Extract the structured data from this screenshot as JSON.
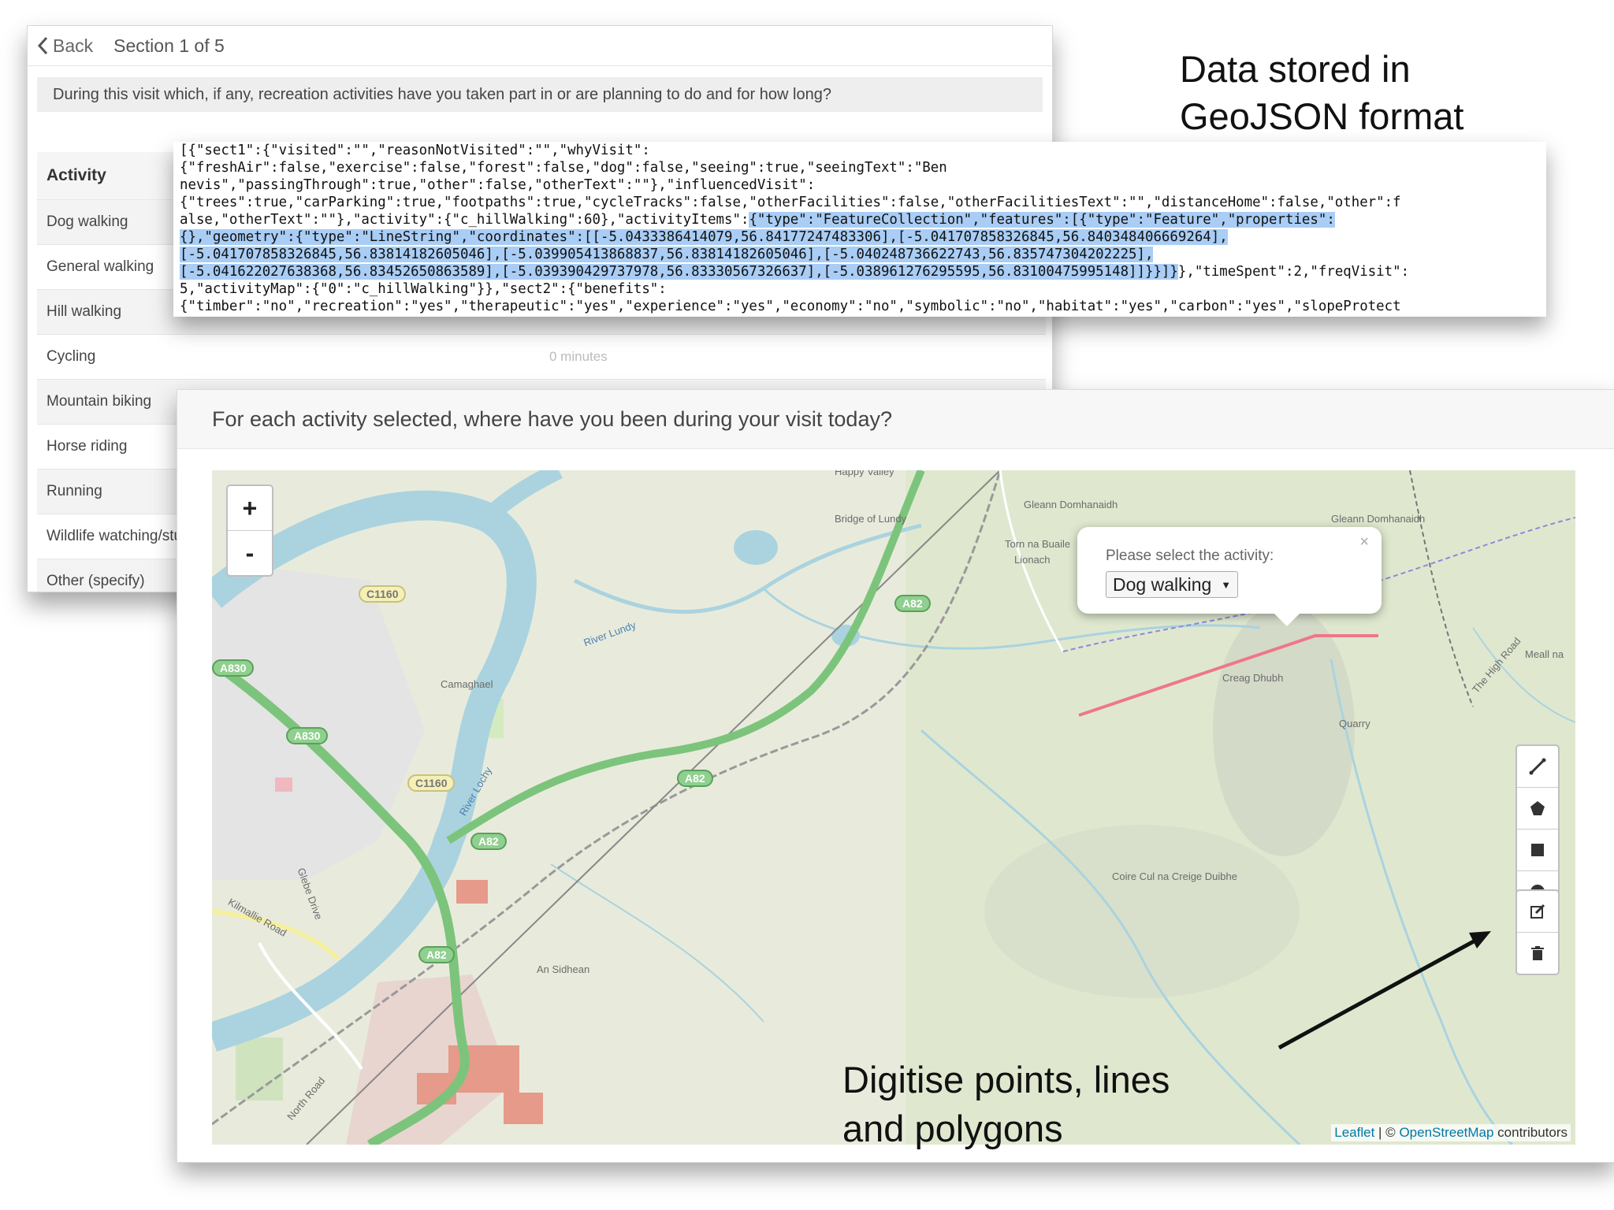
{
  "survey": {
    "back_label": "Back",
    "section_label": "Section 1 of 5",
    "question": "During this visit which, if any, recreation activities have you taken part in or are planning to do and for how long?",
    "activity_header": "Activity",
    "activities": [
      {
        "label": "Dog walking"
      },
      {
        "label": "General walking"
      },
      {
        "label": "Hill walking"
      },
      {
        "label": "Cycling",
        "minutes": "0 minutes"
      },
      {
        "label": "Mountain biking"
      },
      {
        "label": "Horse riding"
      },
      {
        "label": "Running"
      },
      {
        "label": "Wildlife watching/stu"
      },
      {
        "label": "Other (specify)"
      }
    ]
  },
  "json_strip": {
    "lines": [
      {
        "text": "[{\"sect1\":{\"visited\":\"\",\"reasonNotVisited\":\"\",\"whyVisit\":"
      },
      {
        "text": "{\"freshAir\":false,\"exercise\":false,\"forest\":false,\"dog\":false,\"seeing\":true,\"seeingText\":\"Ben"
      },
      {
        "text": "nevis\",\"passingThrough\":true,\"other\":false,\"otherText\":\"\"},\"influencedVisit\":"
      },
      {
        "text": "{\"trees\":true,\"carParking\":true,\"footpaths\":true,\"cycleTracks\":false,\"otherFacilities\":false,\"otherFacilitiesText\":\"\",\"distanceHome\":false,\"other\":f"
      },
      {
        "text": "alse,\"otherText\":\"\"},\"activity\":{\"c_hillWalking\":60},\"activityItems\":",
        "hl": "{\"type\":\"FeatureCollection\",\"features\":[{\"type\":\"Feature\",\"properties\":"
      },
      {
        "text": "",
        "hl": "{},\"geometry\":{\"type\":\"LineString\",\"coordinates\":[[-5.0433386414079,56.84177247483306],[-5.041707858326845,56.840348406669264],"
      },
      {
        "text": "",
        "hl": "[-5.041707858326845,56.83814182605046],[-5.039905413868837,56.83814182605046],[-5.040248736622743,56.835747304202225],"
      },
      {
        "text": "",
        "hl": "[-5.041622027638368,56.83452650863589],[-5.039390429737978,56.83330567326637],[-5.038961276295595,56.83100475995148]]}}]}",
        "after": "},\"timeSpent\":2,\"freqVisit\":"
      },
      {
        "text": "5,\"activityMap\":{\"0\":\"c_hillWalking\"}},\"sect2\":{\"benefits\":"
      },
      {
        "text": "{\"timber\":\"no\",\"recreation\":\"yes\",\"therapeutic\":\"yes\",\"experience\":\"yes\",\"economy\":\"no\",\"symbolic\":\"no\",\"habitat\":\"yes\",\"carbon\":\"yes\",\"slopeProtect"
      }
    ]
  },
  "annotations": {
    "title_line1": "Data stored in",
    "title_line2": "GeoJSON format",
    "digitise_line1": "Digitise points, lines",
    "digitise_line2": "and polygons"
  },
  "map_panel": {
    "question": "For each activity selected, where have you been during your visit today?",
    "zoom_in": "+",
    "zoom_out": "-",
    "popup": {
      "label": "Please select the activity:",
      "selected": "Dog walking",
      "close": "×"
    },
    "attribution": {
      "leaflet": "Leaflet",
      "separator": " | © ",
      "osm": "OpenStreetMap",
      "suffix": " contributors"
    },
    "place_labels": {
      "bridge": "Bridge of Lundy",
      "gleann1": "Gleann Domhanaidh",
      "gleann2": "Gleann Domhanaidh",
      "torn": "Torn na Buaile",
      "lionach": "Lionach",
      "camaghael": "Camaghael",
      "river_lundy": "River Lundy",
      "river_lochy": "River Lochy",
      "creag": "Creag Dhubh",
      "quarry": "Quarry",
      "meall": "Meall na",
      "high_road": "The High Road",
      "coire": "Coire Cul na Creige Duibhe",
      "an_sidhean": "An Sidhean",
      "kilmallie": "Kilmallie Road",
      "glebe": "Glebe Drive",
      "north_road": "North Road",
      "happy": "Happy Valley"
    },
    "road_badges": {
      "c1160a": "C1160",
      "c1160b": "C1160",
      "a830a": "A830",
      "a830b": "A830",
      "a82a": "A82",
      "a82b": "A82",
      "a82c": "A82",
      "a82d": "A82"
    }
  },
  "colors": {
    "drawn_line": "#ee7788",
    "river": "#aad3df",
    "a_road": "#7cc47c",
    "highlight": "#a9cdf5",
    "link": "#0078a8"
  }
}
